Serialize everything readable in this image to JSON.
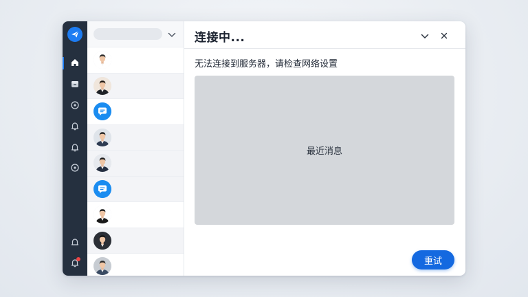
{
  "window": {
    "title": "连接中...",
    "error_message": "无法连接到服务器，请检查网络设置",
    "panel_label": "最近消息",
    "retry_label": "重试"
  },
  "sidebar": {
    "items": [
      {
        "icon": "home-icon",
        "active": true
      },
      {
        "icon": "inbox-icon",
        "active": false
      },
      {
        "icon": "circle-dot-icon",
        "active": false
      },
      {
        "icon": "bell-icon",
        "active": false
      },
      {
        "icon": "bell-icon",
        "active": false
      },
      {
        "icon": "circle-dot-icon",
        "active": false
      }
    ],
    "bottom": [
      {
        "icon": "bell-outline-icon",
        "badge": false
      },
      {
        "icon": "notification-bell-icon",
        "badge": true
      }
    ]
  },
  "contacts": [
    {
      "type": "person",
      "bg": "#ffffff",
      "shirt": "#ffffff",
      "hair": "#2b2b2b"
    },
    {
      "type": "person",
      "bg": "#f0e6dc",
      "shirt": "#1f2328",
      "hair": "#1c1510"
    },
    {
      "type": "chat-app",
      "color": "#1a8cf0"
    },
    {
      "type": "person",
      "bg": "#dfe4ea",
      "shirt": "#2e3b52",
      "hair": "#1f1f1f"
    },
    {
      "type": "person",
      "bg": "#e6e9ee",
      "shirt": "#263042",
      "hair": "#1a1a1a"
    },
    {
      "type": "chat-app",
      "color": "#1a8cf0"
    },
    {
      "type": "person",
      "bg": "#ffffff",
      "shirt": "#1a1a1a",
      "hair": "#1b1b1b"
    },
    {
      "type": "person",
      "bg": "#2b2f36",
      "shirt": "#2b2f36",
      "hair": "#141414"
    },
    {
      "type": "person",
      "bg": "#c7ccd2",
      "shirt": "#3a4b63",
      "hair": "#2a2a2a"
    }
  ],
  "colors": {
    "accent": "#1469e0",
    "rail": "#25303f",
    "badge": "#ef4444"
  }
}
